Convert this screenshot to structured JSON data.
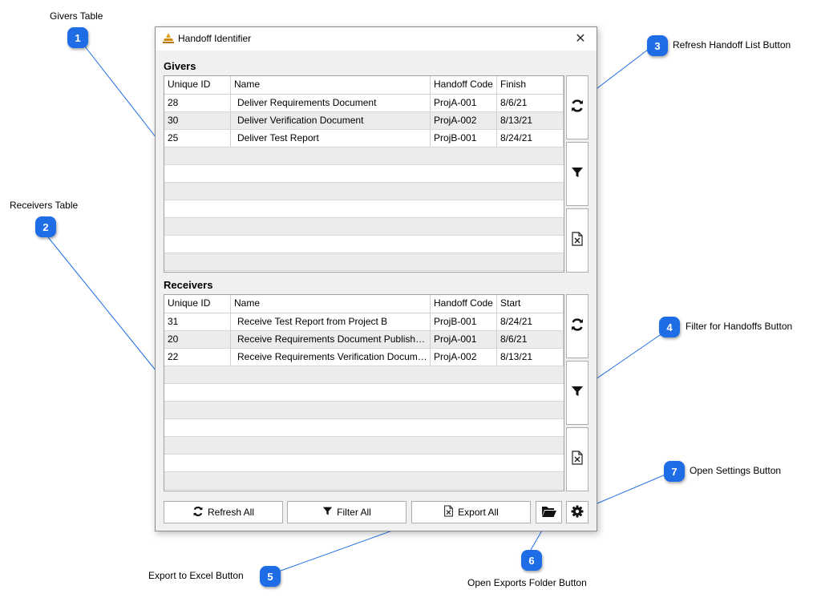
{
  "window": {
    "title": "Handoff Identifier",
    "close_glyph": "✕"
  },
  "givers": {
    "title": "Givers",
    "columns": [
      "Unique ID",
      "Name",
      "Handoff Code",
      "Finish"
    ],
    "rows": [
      [
        "28",
        "Deliver Requirements Document",
        "ProjA-001",
        "8/6/21"
      ],
      [
        "30",
        "Deliver Verification Document",
        "ProjA-002",
        "8/13/21"
      ],
      [
        "25",
        "Deliver Test Report",
        "ProjB-001",
        "8/24/21"
      ]
    ]
  },
  "receivers": {
    "title": "Receivers",
    "columns": [
      "Unique ID",
      "Name",
      "Handoff Code",
      "Start"
    ],
    "rows": [
      [
        "31",
        "Receive Test Report from Project B",
        "ProjB-001",
        "8/24/21"
      ],
      [
        "20",
        "Receive Requirements Document Published...",
        "ProjA-001",
        "8/6/21"
      ],
      [
        "22",
        "Receive Requirements Verification Documen...",
        "ProjA-002",
        "8/13/21"
      ]
    ]
  },
  "buttons": {
    "refresh_all": "Refresh All",
    "filter_all": "Filter All",
    "export_all": "Export All"
  },
  "icons": {
    "refresh": "refresh-icon",
    "filter": "filter-icon",
    "excel": "excel-icon",
    "folder": "folder-open-icon",
    "settings": "gear-icon"
  },
  "callouts": [
    {
      "number": "1",
      "label": "Givers Table"
    },
    {
      "number": "2",
      "label": "Receivers Table"
    },
    {
      "number": "3",
      "label": "Refresh Handoff List Button"
    },
    {
      "number": "4",
      "label": "Filter for Handoffs Button"
    },
    {
      "number": "5",
      "label": "Export to Excel Button"
    },
    {
      "number": "6",
      "label": "Open Exports Folder Button"
    },
    {
      "number": "7",
      "label": "Open Settings Button"
    }
  ],
  "colors": {
    "badge": "#1e6de6",
    "leader_line": "#1e6de6",
    "window_bg": "#f0f0f0"
  }
}
